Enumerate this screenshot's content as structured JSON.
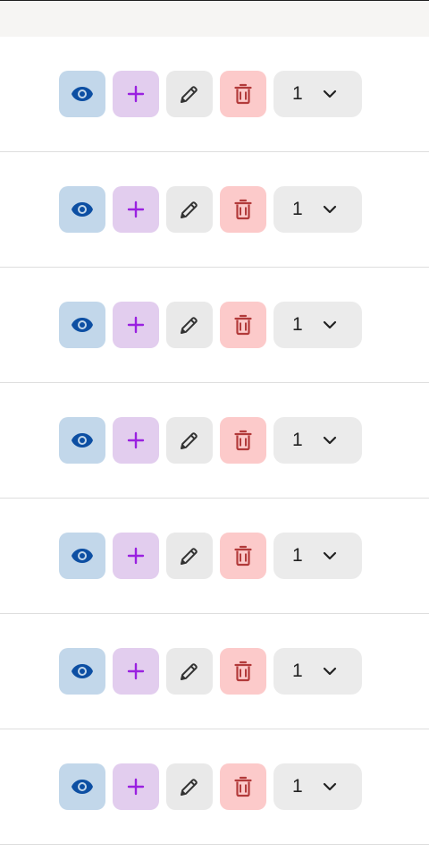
{
  "colors": {
    "view_bg": "#c2d7ea",
    "view_icon": "#0d4fa3",
    "add_bg": "#e2cdee",
    "add_icon": "#9a21e0",
    "edit_bg": "#e9e9e9",
    "edit_icon": "#333333",
    "delete_bg": "#fccaca",
    "delete_icon": "#b23a3a",
    "select_bg": "#ebebeb",
    "header_strip": "#f6f5f3",
    "row_divider": "#dedede"
  },
  "icons": {
    "view": "eye-icon",
    "add": "plus-icon",
    "edit": "pencil-icon",
    "delete": "trash-icon",
    "dropdown": "chevron-down-icon"
  },
  "rows": [
    {
      "quantity": "1"
    },
    {
      "quantity": "1"
    },
    {
      "quantity": "1"
    },
    {
      "quantity": "1"
    },
    {
      "quantity": "1"
    },
    {
      "quantity": "1"
    },
    {
      "quantity": "1"
    }
  ]
}
